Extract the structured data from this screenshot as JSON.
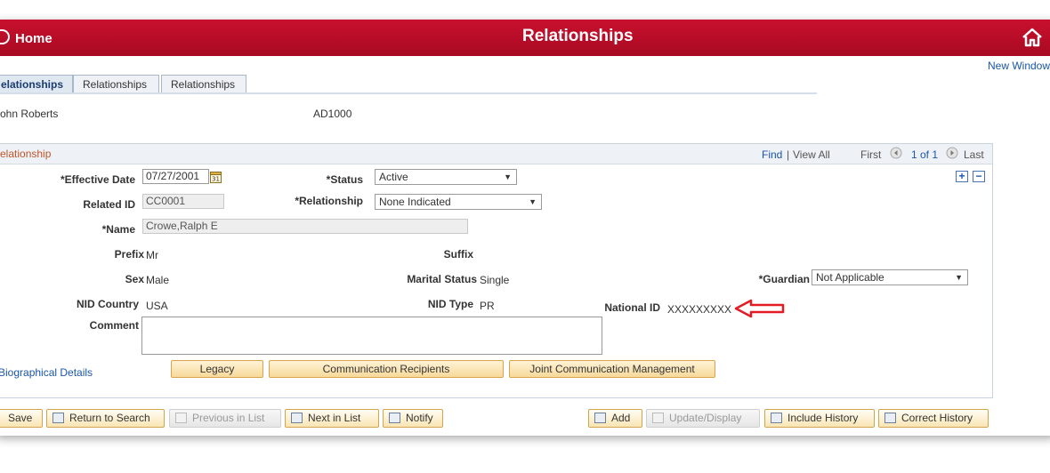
{
  "banner": {
    "home_label": "Home",
    "title": "Relationships"
  },
  "new_window_label": "New Window",
  "tabs": [
    {
      "label": "elationships",
      "active": true
    },
    {
      "label": "Relationships",
      "active": false
    },
    {
      "label": "Relationships",
      "active": false
    }
  ],
  "header": {
    "person_name": "ohn Roberts",
    "person_id": "AD1000"
  },
  "panel": {
    "title": "elationship",
    "find": "Find",
    "view_all": "View All",
    "separator": "|",
    "first": "First",
    "pagination": "1 of 1",
    "last": "Last"
  },
  "fields": {
    "effective_date": {
      "label": "*Effective Date",
      "value": "07/27/2001"
    },
    "status": {
      "label": "*Status",
      "value": "Active"
    },
    "related_id": {
      "label": "Related ID",
      "value": "CC0001"
    },
    "relationship": {
      "label": "*Relationship",
      "value": "None Indicated"
    },
    "name": {
      "label": "*Name",
      "value": "Crowe,Ralph E"
    },
    "prefix": {
      "label": "Prefix",
      "value": "Mr"
    },
    "suffix": {
      "label": "Suffix",
      "value": ""
    },
    "sex": {
      "label": "Sex",
      "value": "Male"
    },
    "marital_status": {
      "label": "Marital Status",
      "value": "Single"
    },
    "guardian": {
      "label": "*Guardian",
      "value": "Not Applicable"
    },
    "nid_country": {
      "label": "NID Country",
      "value": "USA"
    },
    "nid_type": {
      "label": "NID Type",
      "value": "PR"
    },
    "national_id": {
      "label": "National ID",
      "value": "XXXXXXXXX"
    },
    "comment": {
      "label": "Comment",
      "value": ""
    }
  },
  "biographical_details_link": "Biographical Details",
  "panel_buttons": {
    "legacy": "Legacy",
    "communication_recipients": "Communication Recipients",
    "joint_communication_management": "Joint Communication Management"
  },
  "toolbar": {
    "save": "Save",
    "return_to_search": "Return to Search",
    "previous_in_list": "Previous in List",
    "next_in_list": "Next in List",
    "notify": "Notify",
    "add": "Add",
    "update_display": "Update/Display",
    "include_history": "Include History",
    "correct_history": "Correct History"
  },
  "colors": {
    "banner": "#c8102e",
    "link": "#1a56a8",
    "annotation_arrow": "#e31b23"
  },
  "annotation": {
    "type": "arrow",
    "points_to": "national-id-value"
  }
}
